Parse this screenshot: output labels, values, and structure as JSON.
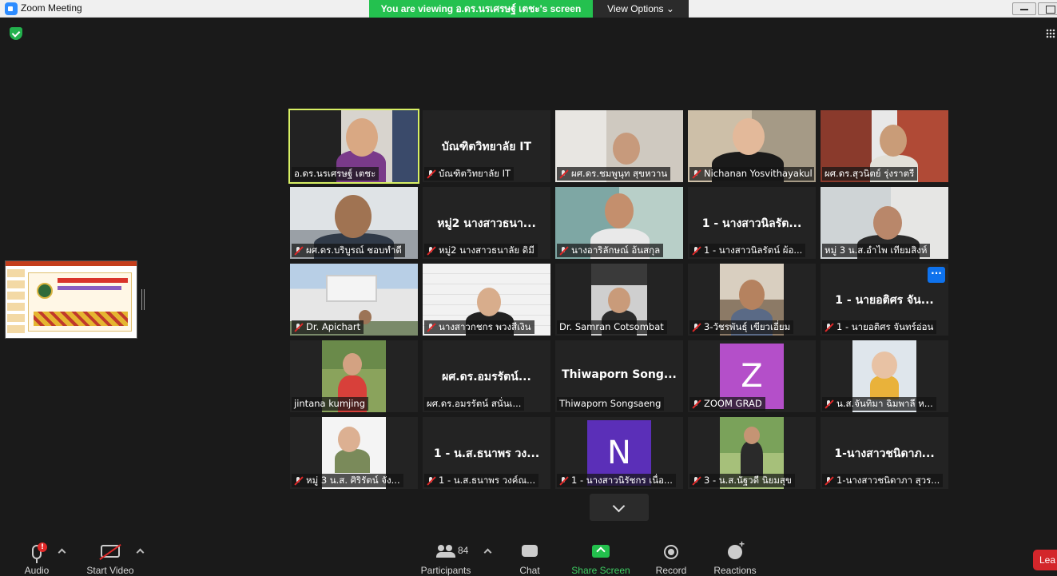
{
  "window": {
    "title": "Zoom Meeting",
    "viewing_banner": "You are viewing อ.ดร.นรเศรษฐ์ เตชะ's screen",
    "view_options": "View Options ⌄"
  },
  "tiles": [
    {
      "label": "อ.ดร.นรเศรษฐ์ เตชะ",
      "center": "",
      "muted": false
    },
    {
      "label": "บัณฑิตวิทยาลัย  IT",
      "center": "บัณฑิตวิทยาลัย  IT",
      "muted": true
    },
    {
      "label": "ผศ.ดร.ชมพูนุท  สุขหวาน",
      "center": "",
      "muted": true
    },
    {
      "label": "Nichanan Yosvithayakul",
      "center": "",
      "muted": true
    },
    {
      "label": "ผศ.ดร.สุวนิตย์ รุ่งราตรี",
      "center": "",
      "muted": false
    },
    {
      "label": "ผศ.ดร.บริบูรณ์ ชอบทำดี",
      "center": "",
      "muted": true
    },
    {
      "label": "หมู่2 นางสาวธนาลัย ดิมี",
      "center": "หมู่2 นางสาวธนา...",
      "muted": true
    },
    {
      "label": "นางอาริลักษณ์ อ้นสกุล",
      "center": "",
      "muted": true
    },
    {
      "label": "1 - นางสาวนิลรัตน์  ผ้อ...",
      "center": "1 - นางสาวนิลรัต...",
      "muted": true
    },
    {
      "label": "หมู่ 3 น.ส.อำไพ  เทียมสิงห์",
      "center": "",
      "muted": false
    },
    {
      "label": "Dr. Apichart",
      "center": "",
      "muted": true
    },
    {
      "label": "นางสาวกชกร พวงสีเงิน",
      "center": "",
      "muted": true
    },
    {
      "label": "Dr. Samran Cotsombat",
      "center": "",
      "muted": false
    },
    {
      "label": "3-วัชรพันธุ์ เขียวเอี่ยม",
      "center": "",
      "muted": true
    },
    {
      "label": "1 - นายอติศร จันทร์อ่อน",
      "center": "1 - นายอติศร จัน...",
      "muted": true
    },
    {
      "label": "jintana kumjing",
      "center": "",
      "muted": false
    },
    {
      "label": "ผศ.ดร.อมรรัตน์  สนั่นเ...",
      "center": "ผศ.ดร.อมรรัตน์...",
      "muted": false
    },
    {
      "label": "Thiwaporn Songsaeng",
      "center": "Thiwaporn  Song...",
      "muted": false
    },
    {
      "label": "ZOOM GRAD",
      "center": "",
      "muted": true
    },
    {
      "label": "น.ส.จันทิมา  ฉิมพาลี  ห...",
      "center": "",
      "muted": true
    },
    {
      "label": "หมู่ 3 น.ส. ศิริรัตน์  จัง...",
      "center": "",
      "muted": true
    },
    {
      "label": "1 - น.ส.ธนาพร วงค์ณ...",
      "center": "1 - น.ส.ธนาพร วง...",
      "muted": true
    },
    {
      "label": "1 - นางสาวนิรัชกร เนื่อ...",
      "center": "",
      "muted": true
    },
    {
      "label": "3 - น.ส.นัฐวดี นิยมสุข",
      "center": "",
      "muted": true
    },
    {
      "label": "1-นางสาวชนิดาภา สุวร...",
      "center": "1-นางสาวชนิดาภ...",
      "muted": true
    }
  ],
  "avatars": {
    "zoom_grad": "Z",
    "niratchakorn": "N"
  },
  "more_button": "···",
  "toolbar": {
    "audio": "Audio",
    "audio_badge": "!",
    "start_video": "Start Video",
    "participants": "Participants",
    "participants_count": "84",
    "chat": "Chat",
    "share_screen": "Share Screen",
    "record": "Record",
    "reactions": "Reactions",
    "leave": "Lea"
  },
  "colors": {
    "share_green": "#24c14f",
    "active_speaker": "#d8f064",
    "leave_red": "#d3262b",
    "avatar_z": "#b44fc9",
    "avatar_n": "#5b2fb8"
  }
}
